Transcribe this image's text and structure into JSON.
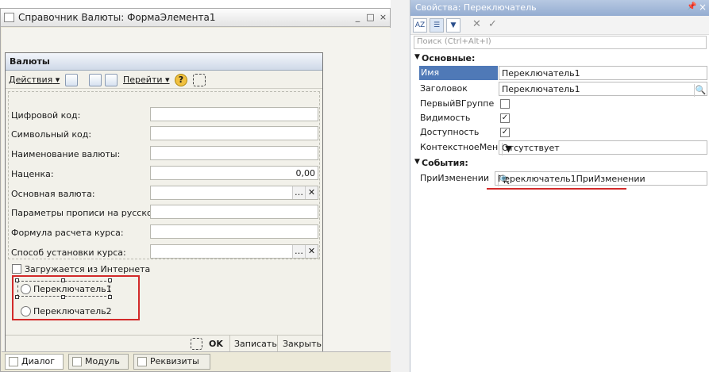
{
  "designer": {
    "title": "Справочник Валюты: ФормаЭлемента1",
    "window_buttons": [
      "_",
      "□",
      "×"
    ],
    "form_title": "Валюты",
    "toolbar": {
      "actions": "Действия",
      "goto": "Перейти",
      "help": "?"
    },
    "fields": [
      {
        "label": "Цифровой код:",
        "value": ""
      },
      {
        "label": "Символьный код:",
        "value": ""
      },
      {
        "label": "Наименование валюты:",
        "value": ""
      },
      {
        "label": "Наценка:",
        "value": "0,00"
      },
      {
        "label": "Основная валюта:",
        "value": ""
      },
      {
        "label": "Параметры прописи на русском:",
        "value": ""
      },
      {
        "label": "Формула расчета курса:",
        "value": ""
      },
      {
        "label": "Способ установки курса:",
        "value": ""
      }
    ],
    "checkbox_label": "Загружается из Интернета",
    "radio1": "Переключатель1",
    "radio2": "Переключатель2",
    "footer": {
      "ok": "OK",
      "save": "Записать",
      "close": "Закрыть"
    },
    "tabs": [
      "Диалог",
      "Модуль",
      "Реквизиты"
    ]
  },
  "props": {
    "title": "Свойства: Переключатель",
    "search_placeholder": "Поиск (Ctrl+Alt+I)",
    "section_main": "Основные:",
    "section_events": "События:",
    "rows": [
      {
        "label": "Имя",
        "value": "Переключатель1"
      },
      {
        "label": "Заголовок",
        "value": "Переключатель1"
      },
      {
        "label": "ПервыйВГруппе",
        "value": ""
      },
      {
        "label": "Видимость",
        "value": "✓"
      },
      {
        "label": "Доступность",
        "value": "✓"
      },
      {
        "label": "КонтекстноеМеню",
        "value": "Отсутствует"
      }
    ],
    "event_row": {
      "label": "ПриИзменении",
      "value": "Переключатель1ПриИзменении"
    }
  },
  "colors": {
    "accent_red": "#d22a2a",
    "selected": "#4f79b7"
  }
}
